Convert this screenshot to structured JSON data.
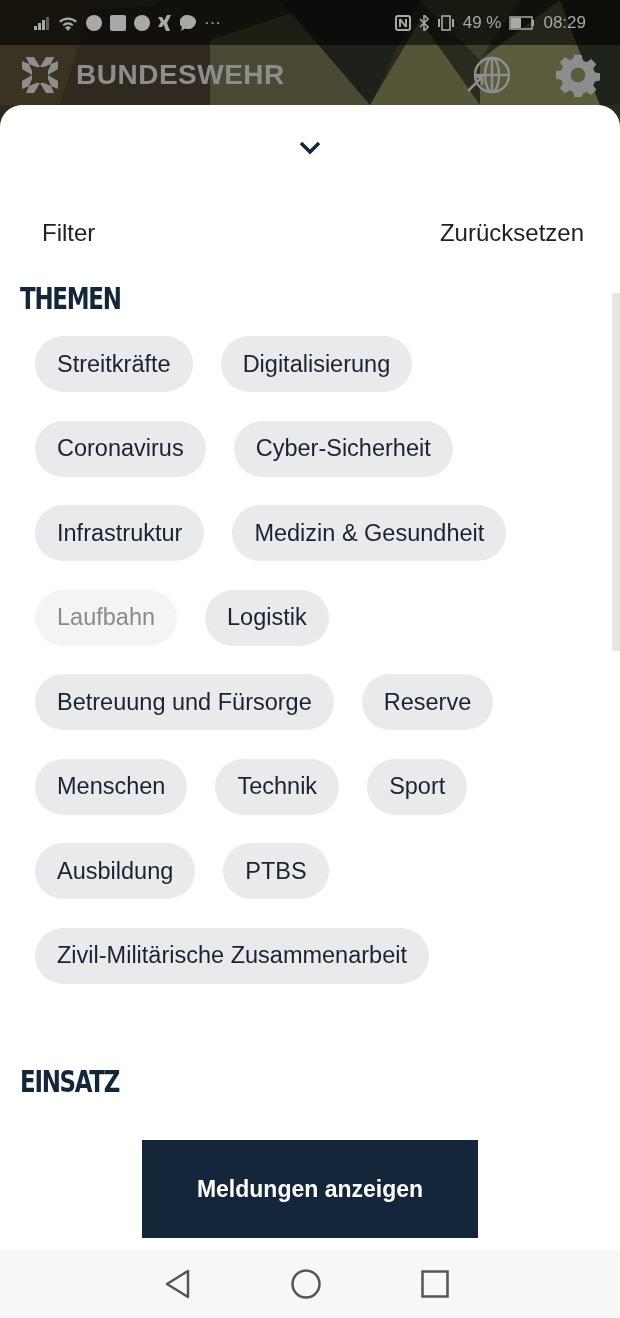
{
  "status_bar": {
    "more": "···",
    "battery": "49 %",
    "time": "08:29"
  },
  "app_header": {
    "title": "BUNDESWEHR"
  },
  "sheet": {
    "filter_label": "Filter",
    "reset": "Zurücksetzen",
    "sections": [
      {
        "title": "THEMEN",
        "chips": [
          {
            "label": "Streitkräfte",
            "disabled": false
          },
          {
            "label": "Digitalisierung",
            "disabled": false
          },
          {
            "label": "Coronavirus",
            "disabled": false
          },
          {
            "label": "Cyber-Sicherheit",
            "disabled": false
          },
          {
            "label": "Infrastruktur",
            "disabled": false
          },
          {
            "label": "Medizin & Gesundheit",
            "disabled": false
          },
          {
            "label": "Laufbahn",
            "disabled": true
          },
          {
            "label": "Logistik",
            "disabled": false
          },
          {
            "label": "Betreuung und Fürsorge",
            "disabled": false
          },
          {
            "label": "Reserve",
            "disabled": false
          },
          {
            "label": "Menschen",
            "disabled": false
          },
          {
            "label": "Technik",
            "disabled": false
          },
          {
            "label": "Sport",
            "disabled": false
          },
          {
            "label": "Ausbildung",
            "disabled": false
          },
          {
            "label": "PTBS",
            "disabled": false
          },
          {
            "label": "Zivil-Militärische Zusammenarbeit",
            "disabled": false
          }
        ]
      },
      {
        "title": "EINSATZ"
      }
    ],
    "button": "Meldungen anzeigen"
  }
}
